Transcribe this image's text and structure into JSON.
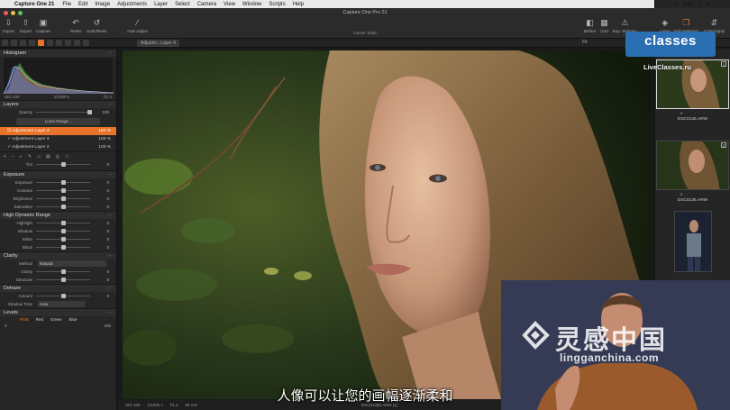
{
  "menubar": {
    "app_name": "Capture One 21",
    "items": [
      "File",
      "Edit",
      "Image",
      "Adjustments",
      "Layer",
      "Select",
      "Camera",
      "View",
      "Window",
      "Scripts",
      "Help"
    ],
    "clock": "0:25"
  },
  "window": {
    "title": "Capture One Pro 21"
  },
  "toolbar": {
    "import": "Import",
    "export": "Export",
    "capture": "Capture",
    "reset": "Reset",
    "undo_redo": "Undo/Redo",
    "auto_adjust": "Auto Adjust",
    "cursor_tools": "Cursor Tools",
    "before": "Before",
    "grid": "Grid",
    "exp_warning": "Exp. Warning",
    "learn": "Learn",
    "edit_selected": "Edit Selected",
    "copy_apply": "Copy/Apply"
  },
  "strip": {
    "layer_select": "Adjustm...Layer 4",
    "fit": "Fit"
  },
  "histogram": {
    "title": "Histogram",
    "iso": "ISO 100",
    "shutter": "1/1000 s",
    "aperture": "f/1.4"
  },
  "layers": {
    "title": "Layers",
    "opacity_label": "Opacity",
    "opacity_value": "100",
    "luma_button": "Luma Range...",
    "items": [
      {
        "name": "Adjustment Layer 4",
        "pct": "100 %",
        "selected": true
      },
      {
        "name": "Adjustment Layer 3",
        "pct": "100 %",
        "selected": false
      },
      {
        "name": "Adjustment Layer 2",
        "pct": "100 %",
        "selected": false
      }
    ]
  },
  "tint": {
    "label": "Tint",
    "value": "0",
    "level": 0.5
  },
  "exposure": {
    "title": "Exposure",
    "rows": [
      {
        "label": "Exposure",
        "value": "0",
        "level": 0.5
      },
      {
        "label": "Contrast",
        "value": "0",
        "level": 0.5
      },
      {
        "label": "Brightness",
        "value": "0",
        "level": 0.5
      },
      {
        "label": "Saturation",
        "value": "0",
        "level": 0.5
      }
    ]
  },
  "hdr": {
    "title": "High Dynamic Range",
    "rows": [
      {
        "label": "Highlight",
        "value": "0",
        "level": 0.5
      },
      {
        "label": "Shadow",
        "value": "0",
        "level": 0.5
      },
      {
        "label": "White",
        "value": "0",
        "level": 0.5
      },
      {
        "label": "Black",
        "value": "0",
        "level": 0.5
      }
    ]
  },
  "clarity": {
    "title": "Clarity",
    "method_label": "Method",
    "method_value": "Natural",
    "rows": [
      {
        "label": "Clarity",
        "value": "0",
        "level": 0.5
      },
      {
        "label": "Structure",
        "value": "0",
        "level": 0.5
      }
    ]
  },
  "dehaze": {
    "title": "Dehaze",
    "amount_label": "Amount",
    "amount_value": "0",
    "amount_level": 0.5,
    "tone_label": "Shadow Tone",
    "tone_value": "Auto"
  },
  "levels": {
    "title": "Levels",
    "tabs": [
      "RGB",
      "Red",
      "Green",
      "Blue"
    ],
    "low": "0",
    "high": "255"
  },
  "viewer": {
    "iso": "ISO 100",
    "shutter": "1/1000 s",
    "aperture": "f/1.4",
    "focal": "85 mm",
    "filename": "DSC0135b.ARW [1]"
  },
  "browser": {
    "thumbs": [
      {
        "name": "DSC0135.ARW",
        "badge": "1"
      },
      {
        "name": "DSC0135.ARW",
        "badge": "2"
      },
      {
        "name": "",
        "badge": ""
      }
    ]
  },
  "overlay": {
    "brand": "classes",
    "site": "LiveClasses.ru",
    "subtitle": "人像可以让您的画幅逐渐柔和",
    "wm_cn": "灵感中国",
    "wm_en": "lingganchina.com"
  },
  "colors": {
    "accent": "#e8732a",
    "brand": "#2a6fb2"
  }
}
